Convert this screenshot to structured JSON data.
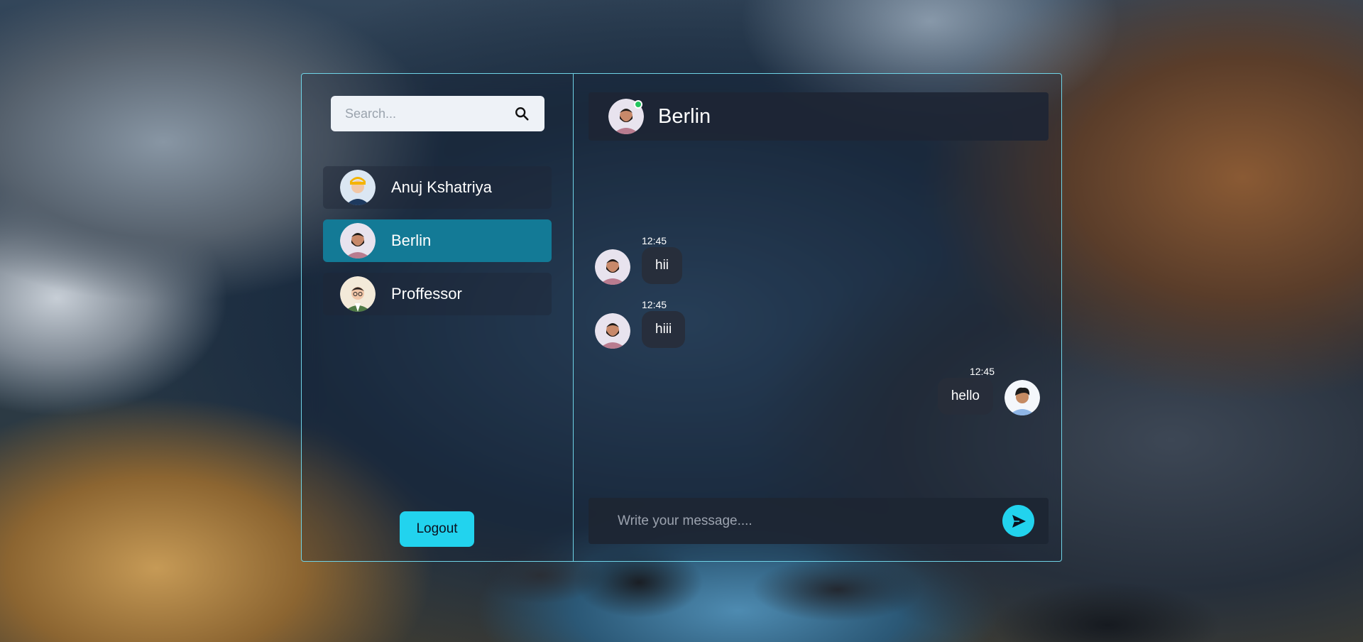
{
  "search": {
    "placeholder": "Search..."
  },
  "contacts": [
    {
      "name": "Anuj Kshatriya",
      "avatar": "avatar-yellow-cap"
    },
    {
      "name": "Berlin",
      "avatar": "avatar-bearded-man",
      "active": true
    },
    {
      "name": "Proffessor",
      "avatar": "avatar-man-glasses"
    }
  ],
  "sidebar": {
    "logout_label": "Logout"
  },
  "chat": {
    "title": "Berlin",
    "online": true,
    "messages": [
      {
        "direction": "in",
        "text": "hii",
        "time": "12:45"
      },
      {
        "direction": "in",
        "text": "hiii",
        "time": "12:45"
      },
      {
        "direction": "out",
        "text": "hello",
        "time": "12:45"
      }
    ],
    "composer_placeholder": "Write your message...."
  },
  "colors": {
    "accent": "#22d3ee",
    "active_contact": "#137a96",
    "border": "#6fd3e6",
    "online": "#22c55e"
  }
}
